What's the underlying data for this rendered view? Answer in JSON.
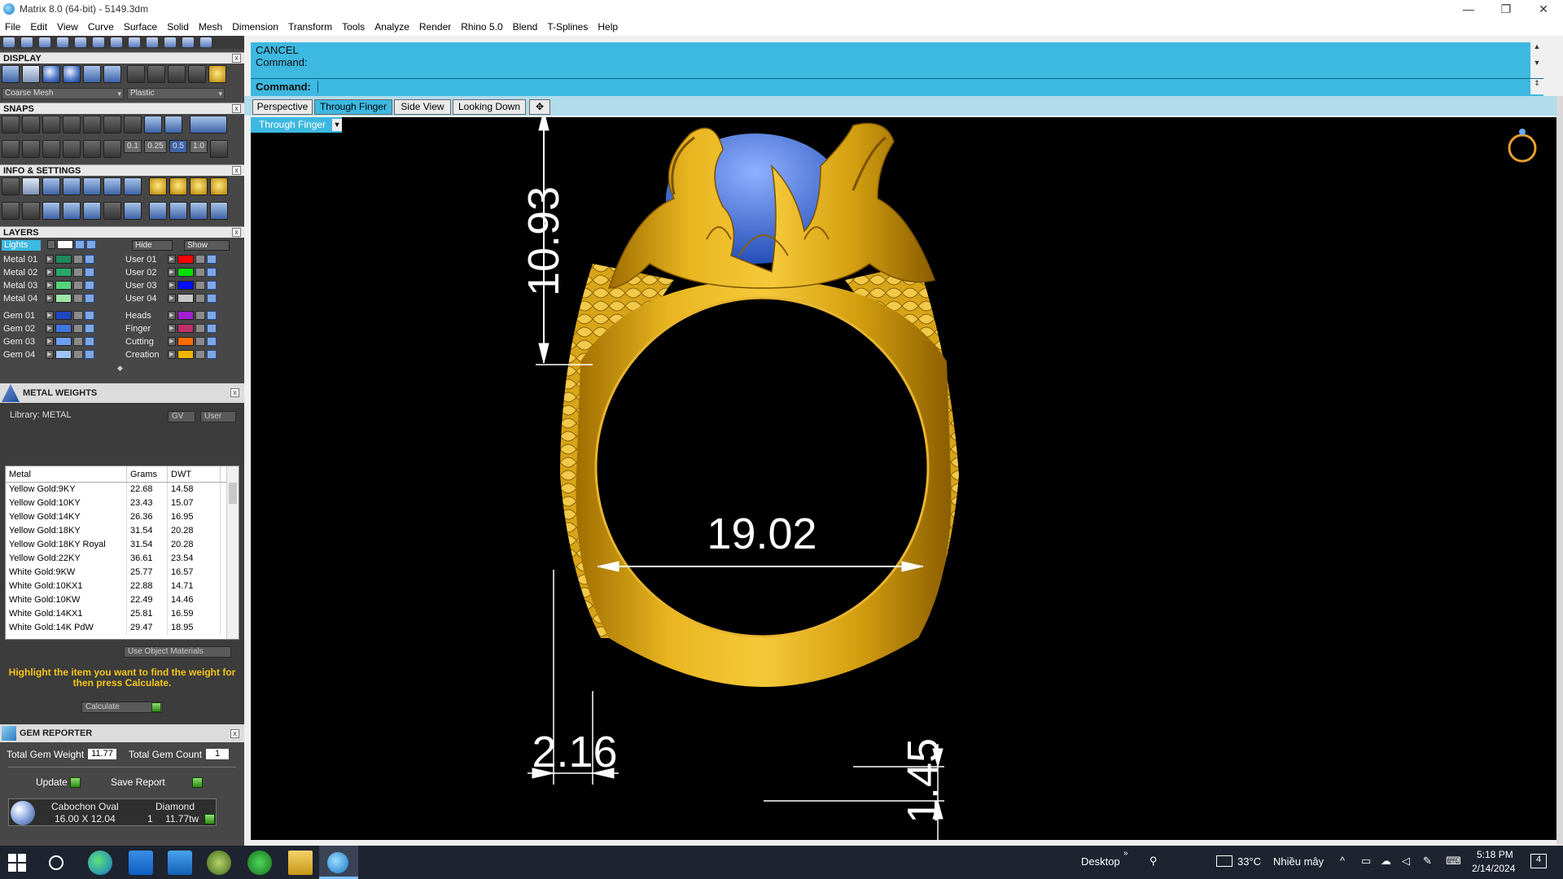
{
  "window": {
    "title": "Matrix 8.0 (64-bit) - 5149.3dm"
  },
  "menu": [
    "File",
    "Edit",
    "View",
    "Curve",
    "Surface",
    "Solid",
    "Mesh",
    "Dimension",
    "Transform",
    "Tools",
    "Analyze",
    "Render",
    "Rhino 5.0",
    "Blend",
    "T-Splines",
    "Help"
  ],
  "panels": {
    "display": {
      "title": "DISPLAY",
      "mesh_option": "Coarse Mesh",
      "material_option": "Plastic"
    },
    "snaps": {
      "title": "SNAPS",
      "values": [
        "0.1",
        "0.25",
        "0.5",
        "1.0"
      ]
    },
    "info": {
      "title": "INFO & SETTINGS"
    },
    "layers": {
      "title": "LAYERS",
      "lights_label": "Lights",
      "hide_label": "Hide",
      "show_label": "Show",
      "left": [
        {
          "name": "Metal 01",
          "color": "#1e8a5a"
        },
        {
          "name": "Metal 02",
          "color": "#29a86a"
        },
        {
          "name": "Metal 03",
          "color": "#52d47e"
        },
        {
          "name": "Metal 04",
          "color": "#9ee6a8"
        },
        {
          "name": "Gem 01",
          "color": "#1f47c2"
        },
        {
          "name": "Gem 02",
          "color": "#3f77e0"
        },
        {
          "name": "Gem 03",
          "color": "#6d9ef0"
        },
        {
          "name": "Gem 04",
          "color": "#9fc2f5"
        }
      ],
      "right": [
        {
          "name": "User 01",
          "color": "#ff0000"
        },
        {
          "name": "User 02",
          "color": "#00e000"
        },
        {
          "name": "User 03",
          "color": "#0010ff"
        },
        {
          "name": "User 04",
          "color": "#c8c8c8"
        },
        {
          "name": "Heads",
          "color": "#a020d0"
        },
        {
          "name": "Finger",
          "color": "#c0306a"
        },
        {
          "name": "Cutting",
          "color": "#ff6a00"
        },
        {
          "name": "Creation",
          "color": "#f0b400"
        }
      ]
    },
    "metal_weights": {
      "title": "METAL WEIGHTS",
      "library": "Library: METAL",
      "gv_label": "GV",
      "user_label": "User",
      "columns": [
        "Metal",
        "Grams",
        "DWT"
      ],
      "rows": [
        [
          "Yellow Gold:9KY",
          "22.68",
          "14.58"
        ],
        [
          "Yellow Gold:10KY",
          "23.43",
          "15.07"
        ],
        [
          "Yellow Gold:14KY",
          "26.36",
          "16.95"
        ],
        [
          "Yellow Gold:18KY",
          "31.54",
          "20.28"
        ],
        [
          "Yellow Gold:18KY Royal",
          "31.54",
          "20.28"
        ],
        [
          "Yellow Gold:22KY",
          "36.61",
          "23.54"
        ],
        [
          "White Gold:9KW",
          "25.77",
          "16.57"
        ],
        [
          "White Gold:10KX1",
          "22.88",
          "14.71"
        ],
        [
          "White Gold:10KW",
          "22.49",
          "14.46"
        ],
        [
          "White Gold:14KX1",
          "25.81",
          "16.59"
        ],
        [
          "White Gold:14K PdW",
          "29.47",
          "18.95"
        ]
      ],
      "use_object_materials": "Use Object Materials",
      "help": "Highlight the item you want to find the weight for then press Calculate.",
      "calculate": "Calculate"
    },
    "gem_reporter": {
      "title": "GEM REPORTER",
      "total_weight_label": "Total Gem Weight",
      "total_weight": "11.77",
      "total_count_label": "Total Gem Count",
      "total_count": "1",
      "update": "Update",
      "save_report": "Save Report",
      "gem": {
        "shape": "Cabochon Oval",
        "type": "Diamond",
        "size": "16.00 X 12.04",
        "count": "1",
        "weight": "11.77tw"
      }
    }
  },
  "command": {
    "line1": "CANCEL",
    "line2": "Command:",
    "prompt": "Command:"
  },
  "tabs": [
    "Perspective",
    "Through Finger",
    "Side View",
    "Looking Down"
  ],
  "active_tab": "Through Finger",
  "viewport": {
    "name": "Through Finger",
    "dimensions": {
      "height": "10.93",
      "inner": "19.02",
      "thickness": "2.16",
      "bottom": "1.45"
    }
  },
  "taskbar": {
    "desktop": "Desktop",
    "temperature": "33°C",
    "weather": "Nhiều mây",
    "time": "5:18 PM",
    "date": "2/14/2024",
    "notifications": "4"
  }
}
